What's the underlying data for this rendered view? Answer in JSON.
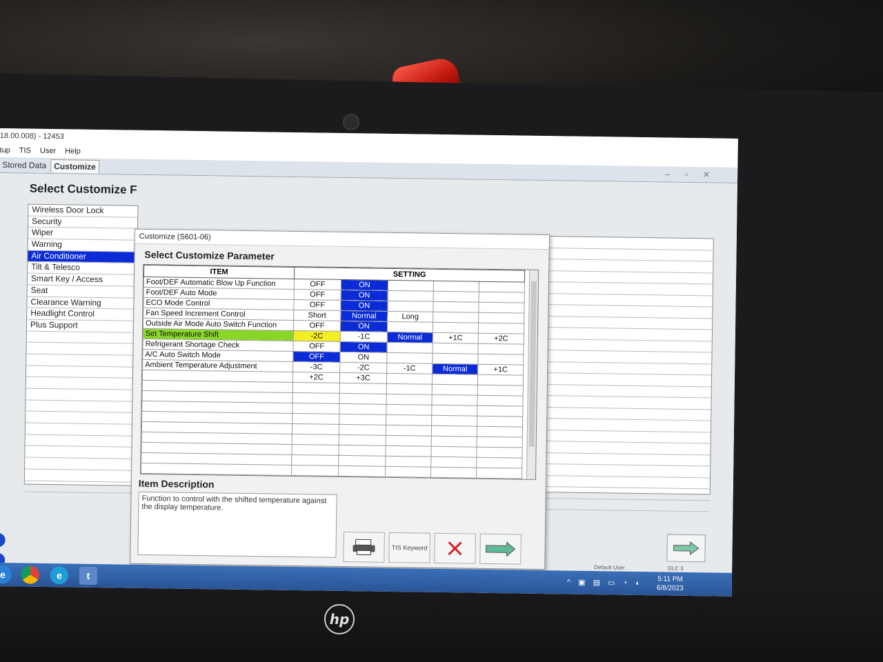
{
  "window": {
    "title": "18.00.008) - 12453",
    "controls": [
      "–",
      "▫",
      "✕"
    ]
  },
  "menu": [
    "tup",
    "TIS",
    "User",
    "Help"
  ],
  "tabs": [
    "Stored Data",
    "Customize"
  ],
  "main": {
    "title": "Select Customize F",
    "functions": [
      "Wireless Door Lock",
      "Security",
      "Wiper",
      "Warning",
      "Air Conditioner",
      "Tilt & Telesco",
      "Smart Key / Access",
      "Seat",
      "Clearance Warning",
      "Headlight Control",
      "Plus Support"
    ],
    "selected_function": "Air Conditioner"
  },
  "dialog": {
    "title": "Customize (S601-06)",
    "heading": "Select Customize Parameter",
    "col_item": "ITEM",
    "col_setting": "SETTING",
    "rows": [
      {
        "item": "Foot/DEF Automatic Blow Up Function",
        "settings": [
          "OFF",
          "ON",
          "",
          "",
          ""
        ],
        "selected": 1
      },
      {
        "item": "Foot/DEF Auto Mode",
        "settings": [
          "OFF",
          "ON",
          "",
          "",
          ""
        ],
        "selected": 1
      },
      {
        "item": "ECO Mode Control",
        "settings": [
          "OFF",
          "ON",
          "",
          "",
          ""
        ],
        "selected": 1
      },
      {
        "item": "Fan Speed Increment Control",
        "settings": [
          "Short",
          "Normal",
          "Long",
          "",
          ""
        ],
        "selected": 1
      },
      {
        "item": "Outside Air Mode Auto Switch Function",
        "settings": [
          "OFF",
          "ON",
          "",
          "",
          ""
        ],
        "selected": 1
      },
      {
        "item": "Set Temperature Shift",
        "settings": [
          "-2C",
          "-1C",
          "Normal",
          "+1C",
          "+2C"
        ],
        "selected": 2,
        "current": 0,
        "highlight": true
      },
      {
        "item": "Refrigerant Shortage Check",
        "settings": [
          "OFF",
          "ON",
          "",
          "",
          ""
        ],
        "selected": 1
      },
      {
        "item": "A/C Auto Switch Mode",
        "settings": [
          "OFF",
          "ON",
          "",
          "",
          ""
        ],
        "selected": 0
      },
      {
        "item": "Ambient Temperature Adjustment",
        "settings": [
          "-3C",
          "-2C",
          "-1C",
          "Normal",
          "+1C"
        ],
        "selected": 3
      },
      {
        "item": "",
        "settings": [
          "+2C",
          "+3C",
          "",
          "",
          ""
        ],
        "selected": -1
      }
    ],
    "empty_rows": 9,
    "description_label": "Item Description",
    "description": "Function to control with the shifted temperature against the display temperature.",
    "buttons": {
      "print": "print",
      "tis_keyword": "TIS Keyword",
      "cancel": "cancel",
      "next": "next"
    }
  },
  "status": {
    "user": "Default User",
    "dlc": "DLC 3"
  },
  "clock": {
    "time": "5:11 PM",
    "date": "6/8/2023"
  },
  "colors": {
    "selected": "#0a2bd6",
    "highlight_item": "#8ad627",
    "current_value": "#f2ee22"
  },
  "brand": "hp"
}
